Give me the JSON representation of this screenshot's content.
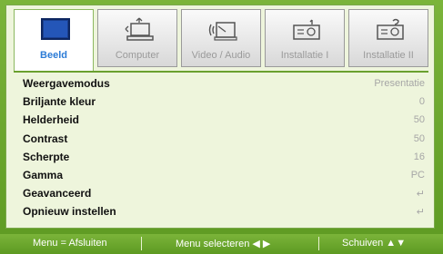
{
  "tabs": [
    {
      "label": "Beeld",
      "icon": "monitor-icon",
      "active": true
    },
    {
      "label": "Computer",
      "icon": "computer-icon",
      "active": false
    },
    {
      "label": "Video / Audio",
      "icon": "video-audio-icon",
      "active": false
    },
    {
      "label": "Installatie I",
      "icon": "projector-icon",
      "active": false
    },
    {
      "label": "Installatie II",
      "icon": "projector-settings-icon",
      "active": false
    }
  ],
  "menu": [
    {
      "label": "Weergavemodus",
      "value": "Presentatie"
    },
    {
      "label": "Briljante kleur",
      "value": "0"
    },
    {
      "label": "Helderheid",
      "value": "50"
    },
    {
      "label": "Contrast",
      "value": "50"
    },
    {
      "label": "Scherpte",
      "value": "16"
    },
    {
      "label": "Gamma",
      "value": "PC"
    },
    {
      "label": "Geavanceerd",
      "value": "↵"
    },
    {
      "label": "Opnieuw instellen",
      "value": "↵"
    }
  ],
  "footer": {
    "exit": "Menu = Afsluiten",
    "select": "Menu selecteren ◀ ▶",
    "scroll": "Schuiven ▲▼"
  },
  "colors": {
    "accent": "#6aa02e",
    "active_tab_text": "#2b7bd6",
    "panel_bg": "#eef5dc"
  }
}
